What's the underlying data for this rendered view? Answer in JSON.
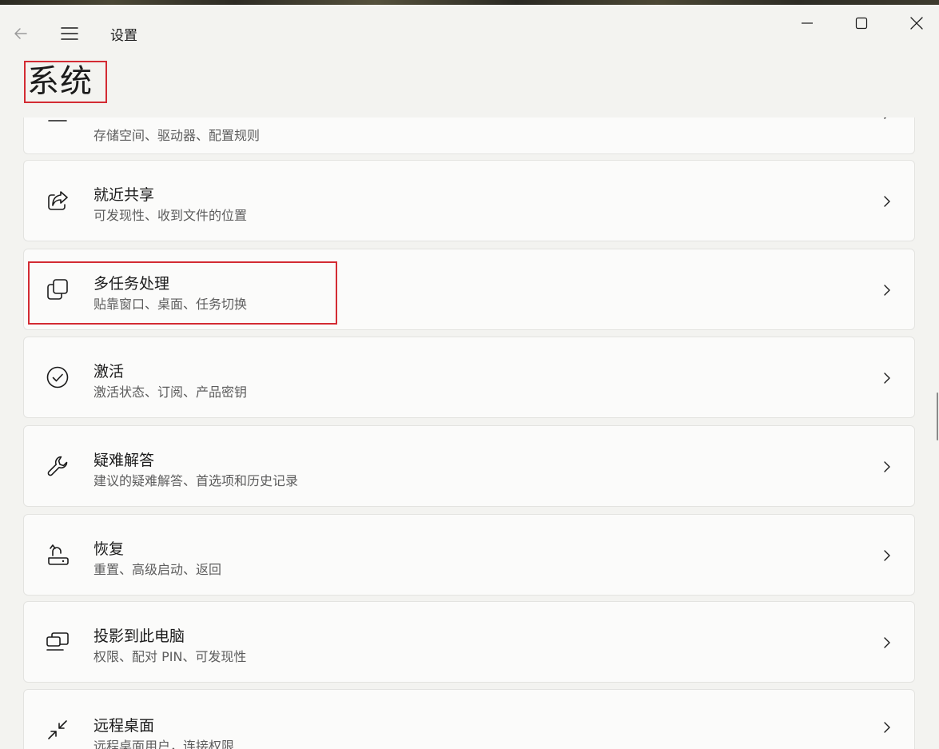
{
  "window": {
    "title": "设置",
    "page_title": "系统",
    "back_icon": "back-arrow-icon",
    "menu_icon": "hamburger-menu-icon",
    "controls": [
      "minimize-icon",
      "maximize-icon",
      "close-icon"
    ]
  },
  "items": [
    {
      "key": "storage",
      "title": "",
      "subtitle": "存储空间、驱动器、配置规则",
      "icon": "storage-icon"
    },
    {
      "key": "nearby-sharing",
      "title": "就近共享",
      "subtitle": "可发现性、收到文件的位置",
      "icon": "share-icon"
    },
    {
      "key": "multitasking",
      "title": "多任务处理",
      "subtitle": "贴靠窗口、桌面、任务切换",
      "icon": "multitasking-icon",
      "highlighted": true
    },
    {
      "key": "activation",
      "title": "激活",
      "subtitle": "激活状态、订阅、产品密钥",
      "icon": "check-circle-icon"
    },
    {
      "key": "troubleshoot",
      "title": "疑难解答",
      "subtitle": "建议的疑难解答、首选项和历史记录",
      "icon": "wrench-icon"
    },
    {
      "key": "recovery",
      "title": "恢复",
      "subtitle": "重置、高级启动、返回",
      "icon": "recovery-icon"
    },
    {
      "key": "projecting",
      "title": "投影到此电脑",
      "subtitle": "权限、配对 PIN、可发现性",
      "icon": "project-to-pc-icon"
    },
    {
      "key": "remote-desktop",
      "title": "远程桌面",
      "subtitle": "远程桌面用户，连接权限",
      "icon": "remote-desktop-icon"
    }
  ],
  "colors": {
    "highlight": "#d32b33",
    "background": "#f3f3f0",
    "card": "#fbfbfa"
  }
}
